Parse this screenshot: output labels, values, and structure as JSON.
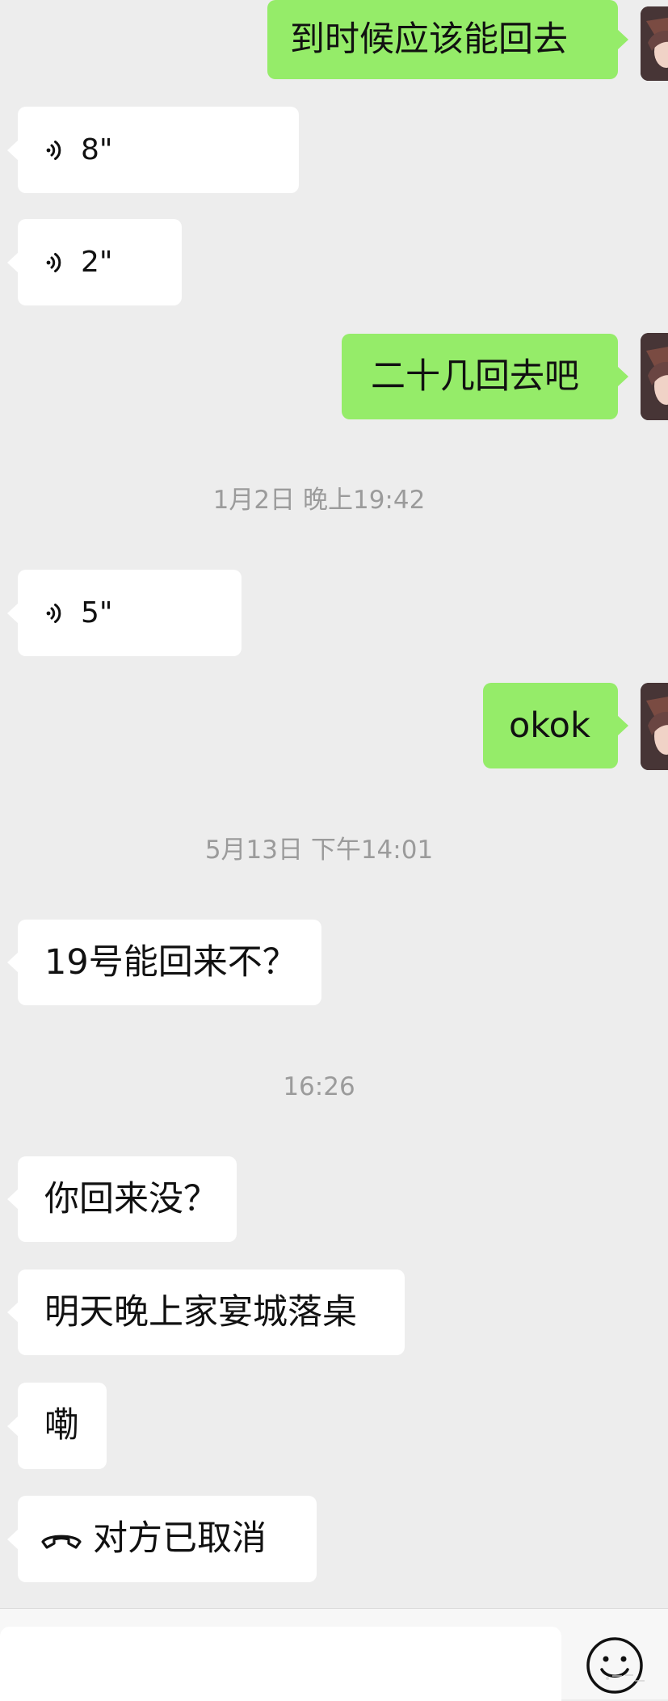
{
  "messages": [
    {
      "type": "text",
      "direction": "out",
      "text": "到时候应该能回去"
    },
    {
      "type": "voice",
      "direction": "in",
      "duration": "8\""
    },
    {
      "type": "voice",
      "direction": "in",
      "duration": "2\""
    },
    {
      "type": "text",
      "direction": "out",
      "text": "二十几回去吧"
    },
    {
      "type": "timestamp",
      "text": "1月2日 晚上19:42"
    },
    {
      "type": "voice",
      "direction": "in",
      "duration": "5\""
    },
    {
      "type": "text",
      "direction": "out",
      "text": "okok"
    },
    {
      "type": "timestamp",
      "text": "5月13日 下午14:01"
    },
    {
      "type": "text",
      "direction": "in",
      "text": "19号能回来不？"
    },
    {
      "type": "timestamp",
      "text": "16:26"
    },
    {
      "type": "text",
      "direction": "in",
      "text": "你回来没？"
    },
    {
      "type": "text",
      "direction": "in",
      "text": "明天晚上家宴城落桌"
    },
    {
      "type": "text",
      "direction": "in",
      "text": "嘞"
    },
    {
      "type": "call",
      "direction": "in",
      "text": "对方已取消"
    }
  ],
  "input_bar": {
    "value": "",
    "placeholder": "",
    "emoji_icon": "smiley-face-icon"
  },
  "icons": {
    "voice": "voice-wave-icon",
    "call": "phone-hangup-icon",
    "avatar": "avatar-image"
  },
  "colors": {
    "chat_background": "#ededed",
    "incoming_bubble": "#ffffff",
    "outgoing_bubble": "#95ec69",
    "timestamp_text": "#9b9b9b"
  }
}
